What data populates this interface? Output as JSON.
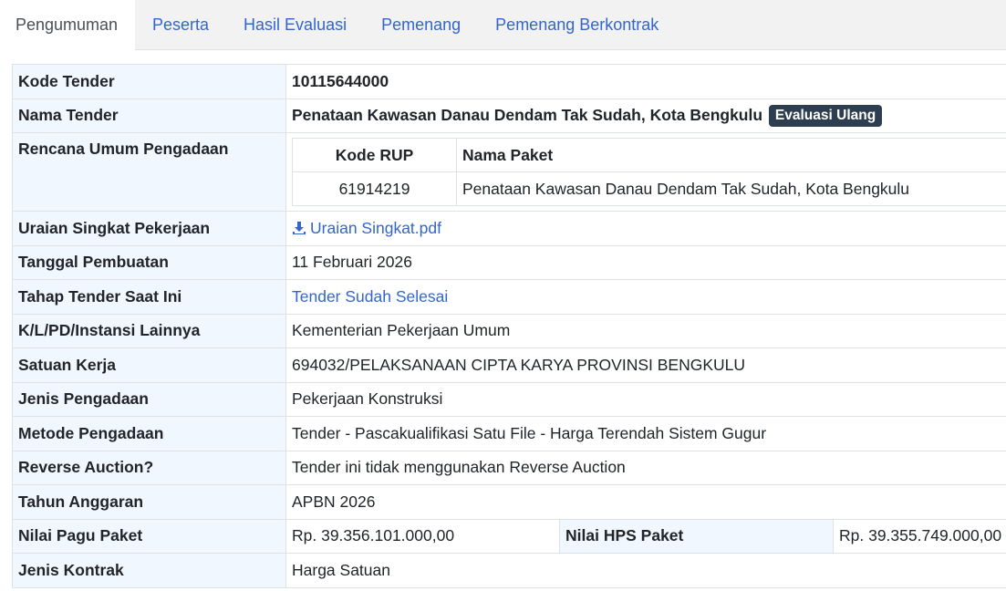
{
  "tabs": [
    {
      "label": "Pengumuman",
      "active": true
    },
    {
      "label": "Peserta",
      "active": false
    },
    {
      "label": "Hasil Evaluasi",
      "active": false
    },
    {
      "label": "Pemenang",
      "active": false
    },
    {
      "label": "Pemenang Berkontrak",
      "active": false
    }
  ],
  "detail": {
    "kode_tender": {
      "label": "Kode Tender",
      "value": "10115644000"
    },
    "nama_tender": {
      "label": "Nama Tender",
      "value": "Penataan Kawasan Danau Dendam Tak Sudah, Kota Bengkulu",
      "badge": "Evaluasi Ulang"
    },
    "rup": {
      "label": "Rencana Umum Pengadaan",
      "headers": [
        "Kode RUP",
        "Nama Paket"
      ],
      "rows": [
        [
          "61914219",
          "Penataan Kawasan Danau Dendam Tak Sudah, Kota Bengkulu"
        ]
      ]
    },
    "uraian": {
      "label": "Uraian Singkat Pekerjaan",
      "value": "Uraian Singkat.pdf",
      "icon": "download-icon"
    },
    "tanggal": {
      "label": "Tanggal Pembuatan",
      "value": "11 Februari 2026"
    },
    "tahap": {
      "label": "Tahap Tender Saat Ini",
      "value": "Tender Sudah Selesai"
    },
    "instansi": {
      "label": "K/L/PD/Instansi Lainnya",
      "value": "Kementerian Pekerjaan Umum"
    },
    "satker": {
      "label": "Satuan Kerja",
      "value": "694032/PELAKSANAAN CIPTA KARYA PROVINSI BENGKULU"
    },
    "jenis_pengadaan": {
      "label": "Jenis Pengadaan",
      "value": "Pekerjaan Konstruksi"
    },
    "metode": {
      "label": "Metode Pengadaan",
      "value": "Tender - Pascakualifikasi Satu File - Harga Terendah Sistem Gugur"
    },
    "reverse": {
      "label": "Reverse Auction?",
      "value": "Tender ini tidak menggunakan Reverse Auction"
    },
    "tahun": {
      "label": "Tahun Anggaran",
      "value": "APBN 2026"
    },
    "pagu": {
      "label": "Nilai Pagu Paket",
      "value": "Rp. 39.356.101.000,00"
    },
    "hps": {
      "label": "Nilai HPS Paket",
      "value": "Rp. 39.355.749.000,00"
    },
    "kontrak": {
      "label": "Jenis Kontrak",
      "value": "Harga Satuan"
    }
  },
  "colors": {
    "link": "#3366cc",
    "label_bg": "#f0f7ff",
    "badge_bg": "#2c3e50",
    "tab_bar_bg": "#f2f2f2"
  }
}
